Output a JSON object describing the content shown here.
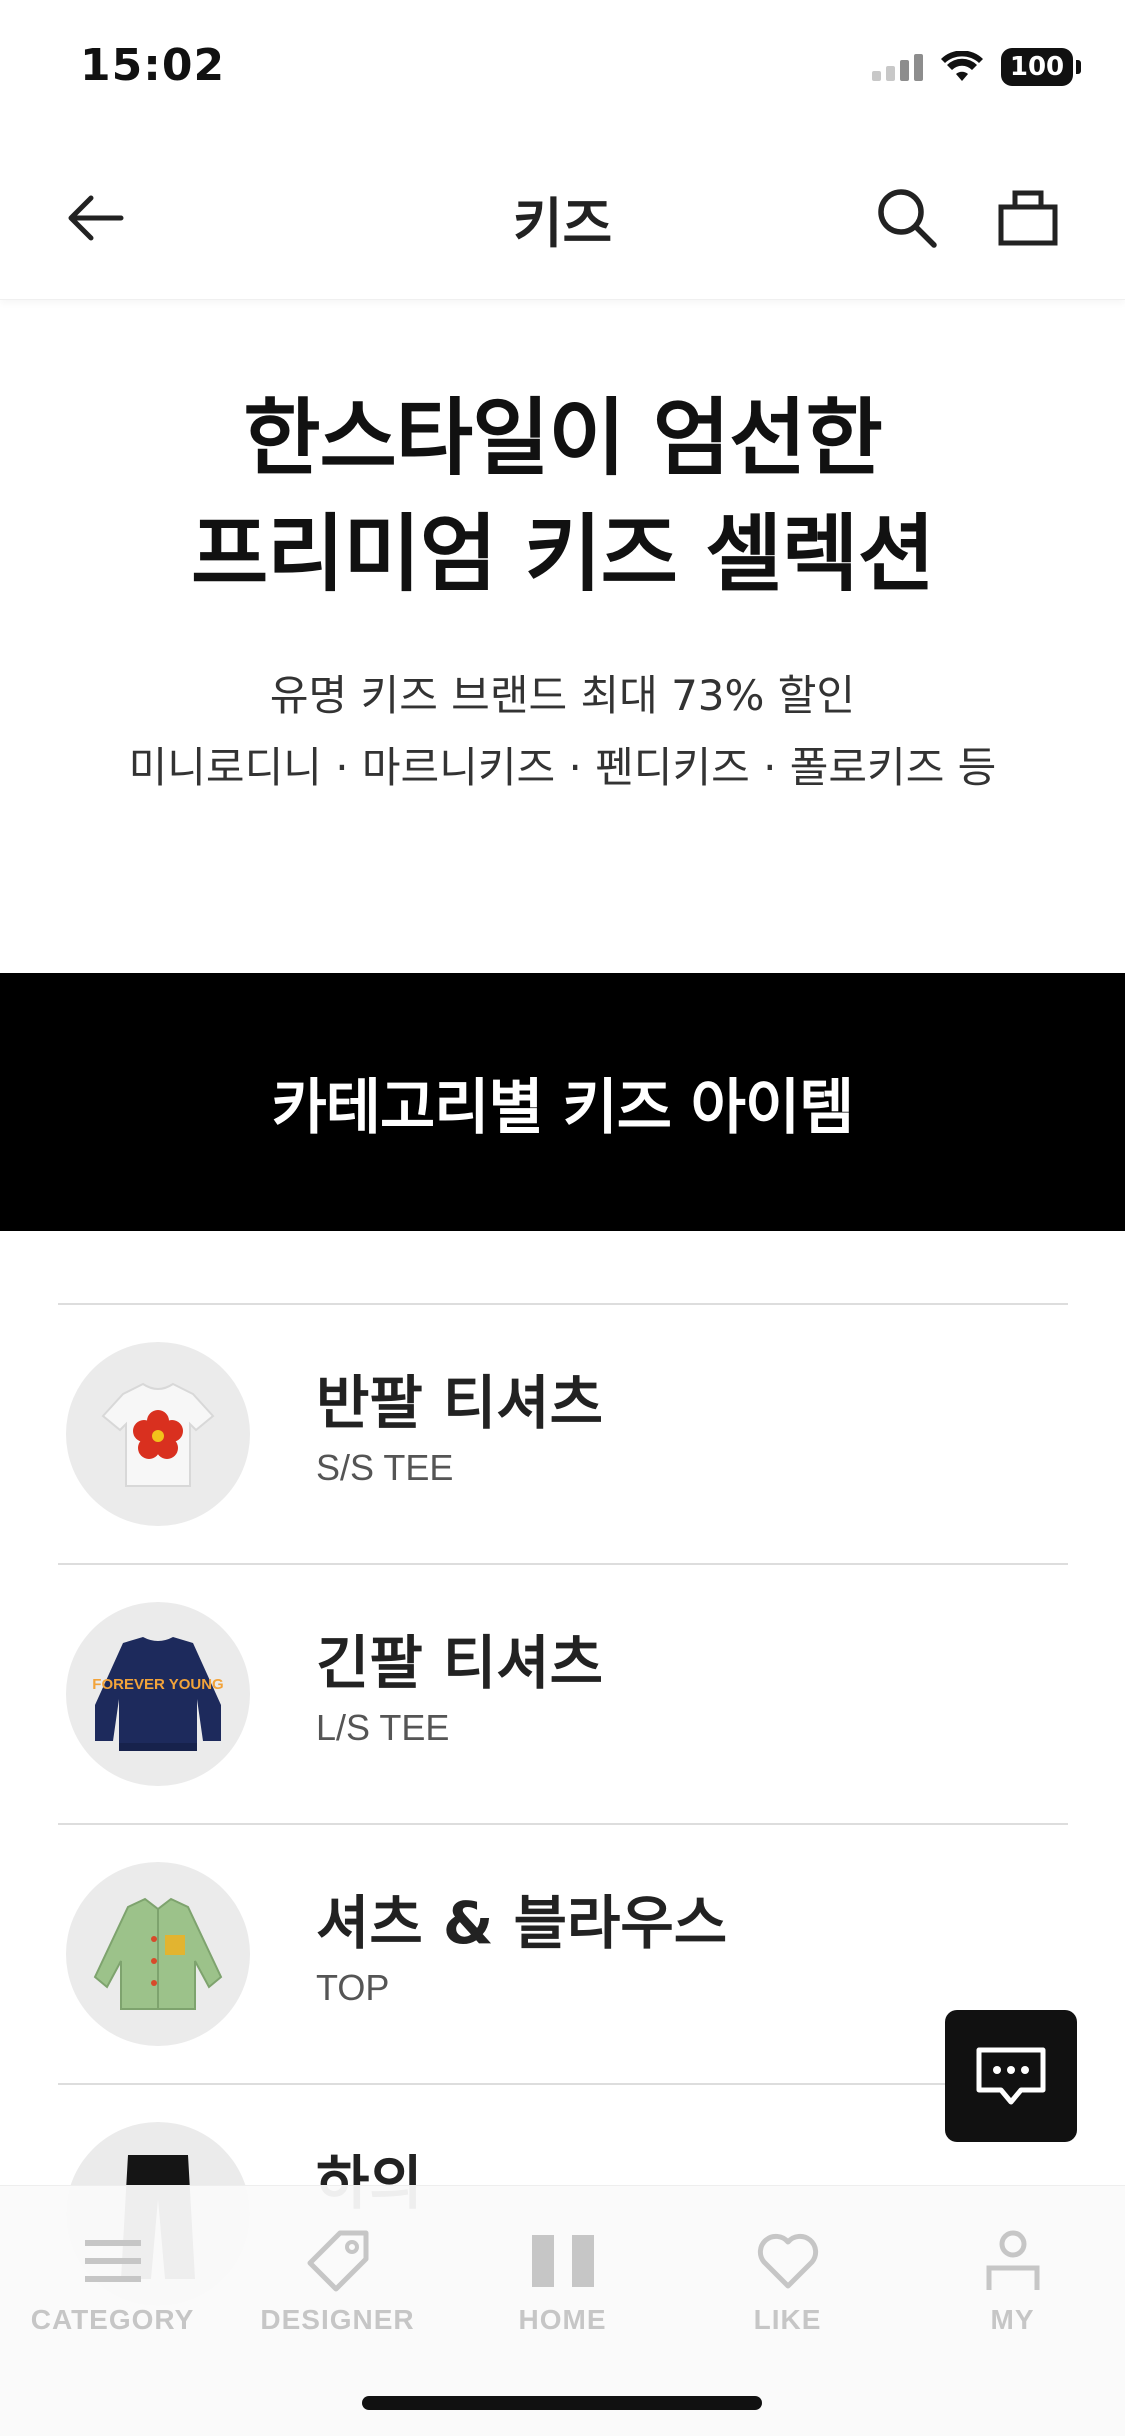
{
  "status_bar": {
    "time": "15:02",
    "battery": "100"
  },
  "header": {
    "title": "키즈"
  },
  "hero": {
    "title_line1": "한스타일이 엄선한",
    "title_line2": "프리미엄 키즈 셀렉션",
    "subtitle_line1": "유명 키즈 브랜드 최대 73% 할인",
    "subtitle_line2": "미니로디니 · 마르니키즈 · 펜디키즈 · 폴로키즈 등"
  },
  "category_banner": {
    "title": "카테고리별 키즈 아이템"
  },
  "categories": [
    {
      "name": "반팔 티셔츠",
      "en": "S/S TEE",
      "image": "white-tee-flower"
    },
    {
      "name": "긴팔 티셔츠",
      "en": "L/S TEE",
      "image": "navy-sweatshirt",
      "print_text": "FOREVER YOUNG"
    },
    {
      "name": "셔츠 & 블라우스",
      "en": "TOP",
      "image": "green-jacket"
    },
    {
      "name": "하의",
      "en": "",
      "image": "black-pants"
    }
  ],
  "tab_bar": {
    "items": [
      {
        "label": "CATEGORY",
        "icon": "menu-icon"
      },
      {
        "label": "DESIGNER",
        "icon": "tag-icon"
      },
      {
        "label": "HOME",
        "icon": "home-icon"
      },
      {
        "label": "LIKE",
        "icon": "heart-icon"
      },
      {
        "label": "MY",
        "icon": "person-icon"
      }
    ]
  },
  "colors": {
    "banner_bg": "#000000",
    "tab_inactive": "#c6c6c6",
    "fab_bg": "#111111"
  }
}
